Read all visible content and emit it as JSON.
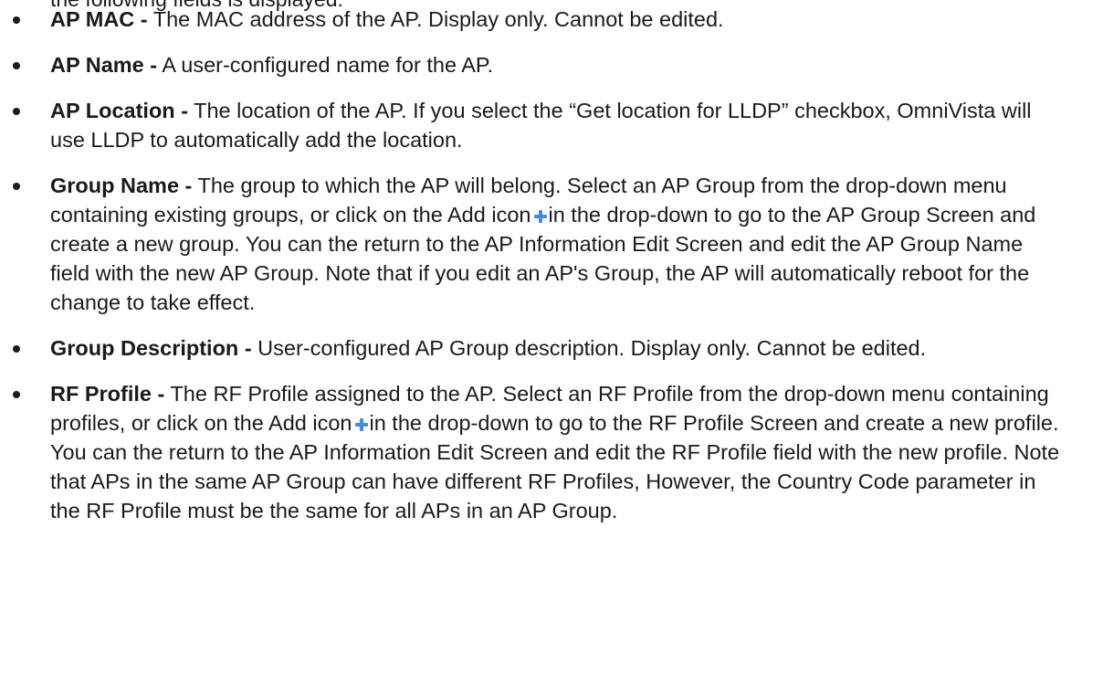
{
  "top_fragment": "the following fields is displayed:",
  "items": [
    {
      "term": "AP MAC -",
      "text": " The MAC address of the AP. Display only. Cannot be edited."
    },
    {
      "term": "AP Name -",
      "text": " A user-configured name for the AP."
    },
    {
      "term": "AP Location -",
      "text": " The location of the AP. If you select the “Get location for LLDP” checkbox, OmniVista will use LLDP to automatically add the location."
    },
    {
      "term": "Group Name -",
      "text_before_icon": " The group to which the AP will belong. Select an AP Group from the drop-down menu containing existing groups, or click on the Add icon",
      "icon": "add-plus-icon",
      "text_after_icon": "in the drop-down to go to the AP Group Screen and create a new group. You can the return to the AP Information Edit Screen and edit the AP Group Name field with the new AP Group. Note that if you edit an AP's Group, the AP will automatically reboot for the change to take effect."
    },
    {
      "term": "Group Description -",
      "text": " User-configured AP Group description. Display only. Cannot be edited."
    },
    {
      "term": "RF Profile -",
      "text_before_icon": " The RF Profile assigned to the AP. Select an RF Profile from the drop-down menu containing profiles, or click on the Add icon",
      "icon": "add-plus-icon",
      "text_after_icon": "in the drop-down to go to the RF Profile Screen and create a new profile. You can the return to the AP Information Edit Screen and edit the RF Profile field with the new profile. Note that APs in the same AP Group can have different RF Profiles, However, the Country Code parameter in the RF Profile must be the same for all APs in an AP Group."
    }
  ],
  "colors": {
    "text": "#1a1a1a",
    "icon_blue": "#3a8fde"
  }
}
